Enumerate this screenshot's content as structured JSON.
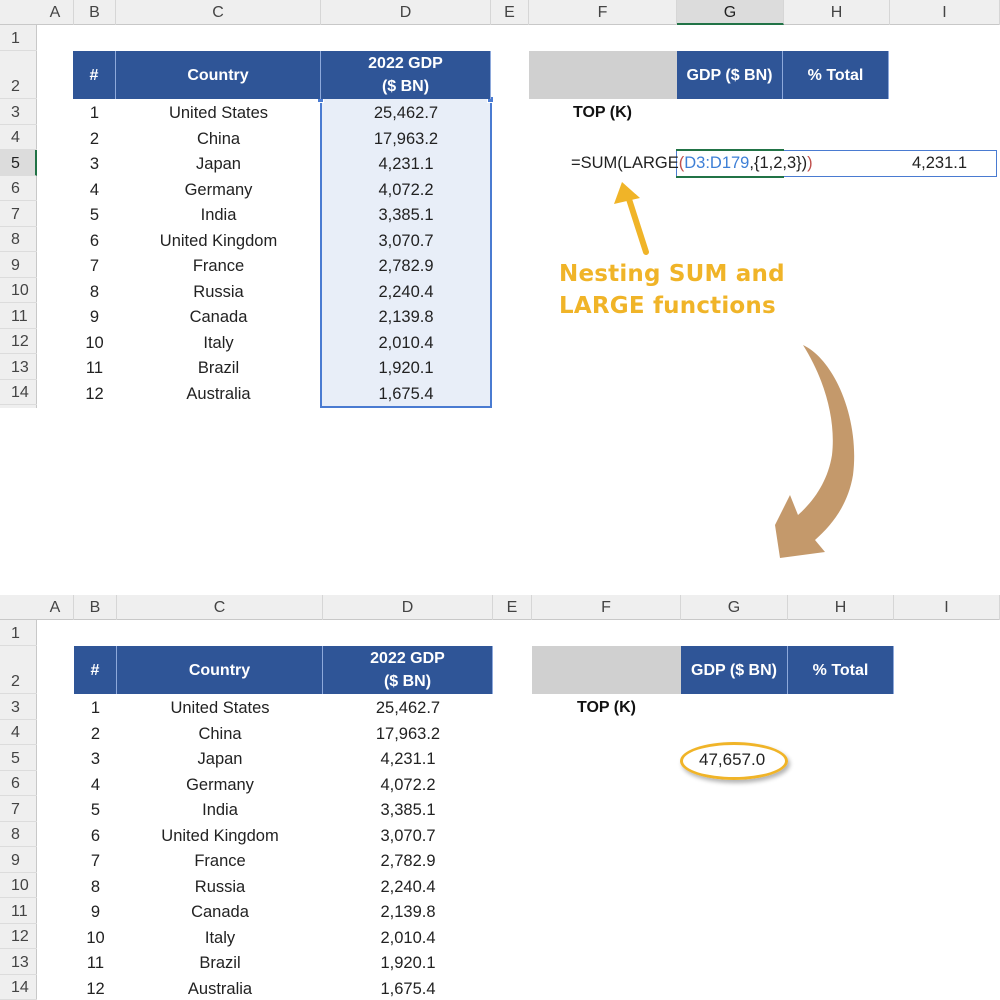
{
  "columns": [
    "A",
    "B",
    "C",
    "D",
    "E",
    "F",
    "G",
    "H",
    "I"
  ],
  "rows": [
    "1",
    "2",
    "3",
    "4",
    "5",
    "6",
    "7",
    "8",
    "9",
    "10",
    "11",
    "12",
    "13",
    "14"
  ],
  "table": {
    "headers": {
      "rank": "#",
      "country": "Country",
      "gdp_line1": "2022 GDP",
      "gdp_line2": "($ BN)"
    },
    "data": [
      {
        "rank": "1",
        "country": "United States",
        "gdp": "25,462.7"
      },
      {
        "rank": "2",
        "country": "China",
        "gdp": "17,963.2"
      },
      {
        "rank": "3",
        "country": "Japan",
        "gdp": "4,231.1"
      },
      {
        "rank": "4",
        "country": "Germany",
        "gdp": "4,072.2"
      },
      {
        "rank": "5",
        "country": "India",
        "gdp": "3,385.1"
      },
      {
        "rank": "6",
        "country": "United Kingdom",
        "gdp": "3,070.7"
      },
      {
        "rank": "7",
        "country": "France",
        "gdp": "2,782.9"
      },
      {
        "rank": "8",
        "country": "Russia",
        "gdp": "2,240.4"
      },
      {
        "rank": "9",
        "country": "Canada",
        "gdp": "2,139.8"
      },
      {
        "rank": "10",
        "country": "Italy",
        "gdp": "2,010.4"
      },
      {
        "rank": "11",
        "country": "Brazil",
        "gdp": "1,920.1"
      },
      {
        "rank": "12",
        "country": "Australia",
        "gdp": "1,675.4"
      }
    ]
  },
  "summary": {
    "gdp_header": "GDP ($ BN)",
    "pct_header": "% Total",
    "topk_label": "TOP (K)"
  },
  "top_panel": {
    "formula_prefix": "=SUM(LARGE",
    "formula_open": "(",
    "formula_ref": "D3:D179",
    "formula_rest": ",{1,2,3})",
    "formula_close": ")",
    "trailing_value": "4,231.1",
    "annotation_line1": "Nesting SUM and",
    "annotation_line2": "LARGE functions"
  },
  "bottom_panel": {
    "result_value": "47,657.0"
  },
  "colors": {
    "header_blue": "#2f5597",
    "annotation_yellow": "#f0b428",
    "arrow_brown": "#c4996b"
  }
}
